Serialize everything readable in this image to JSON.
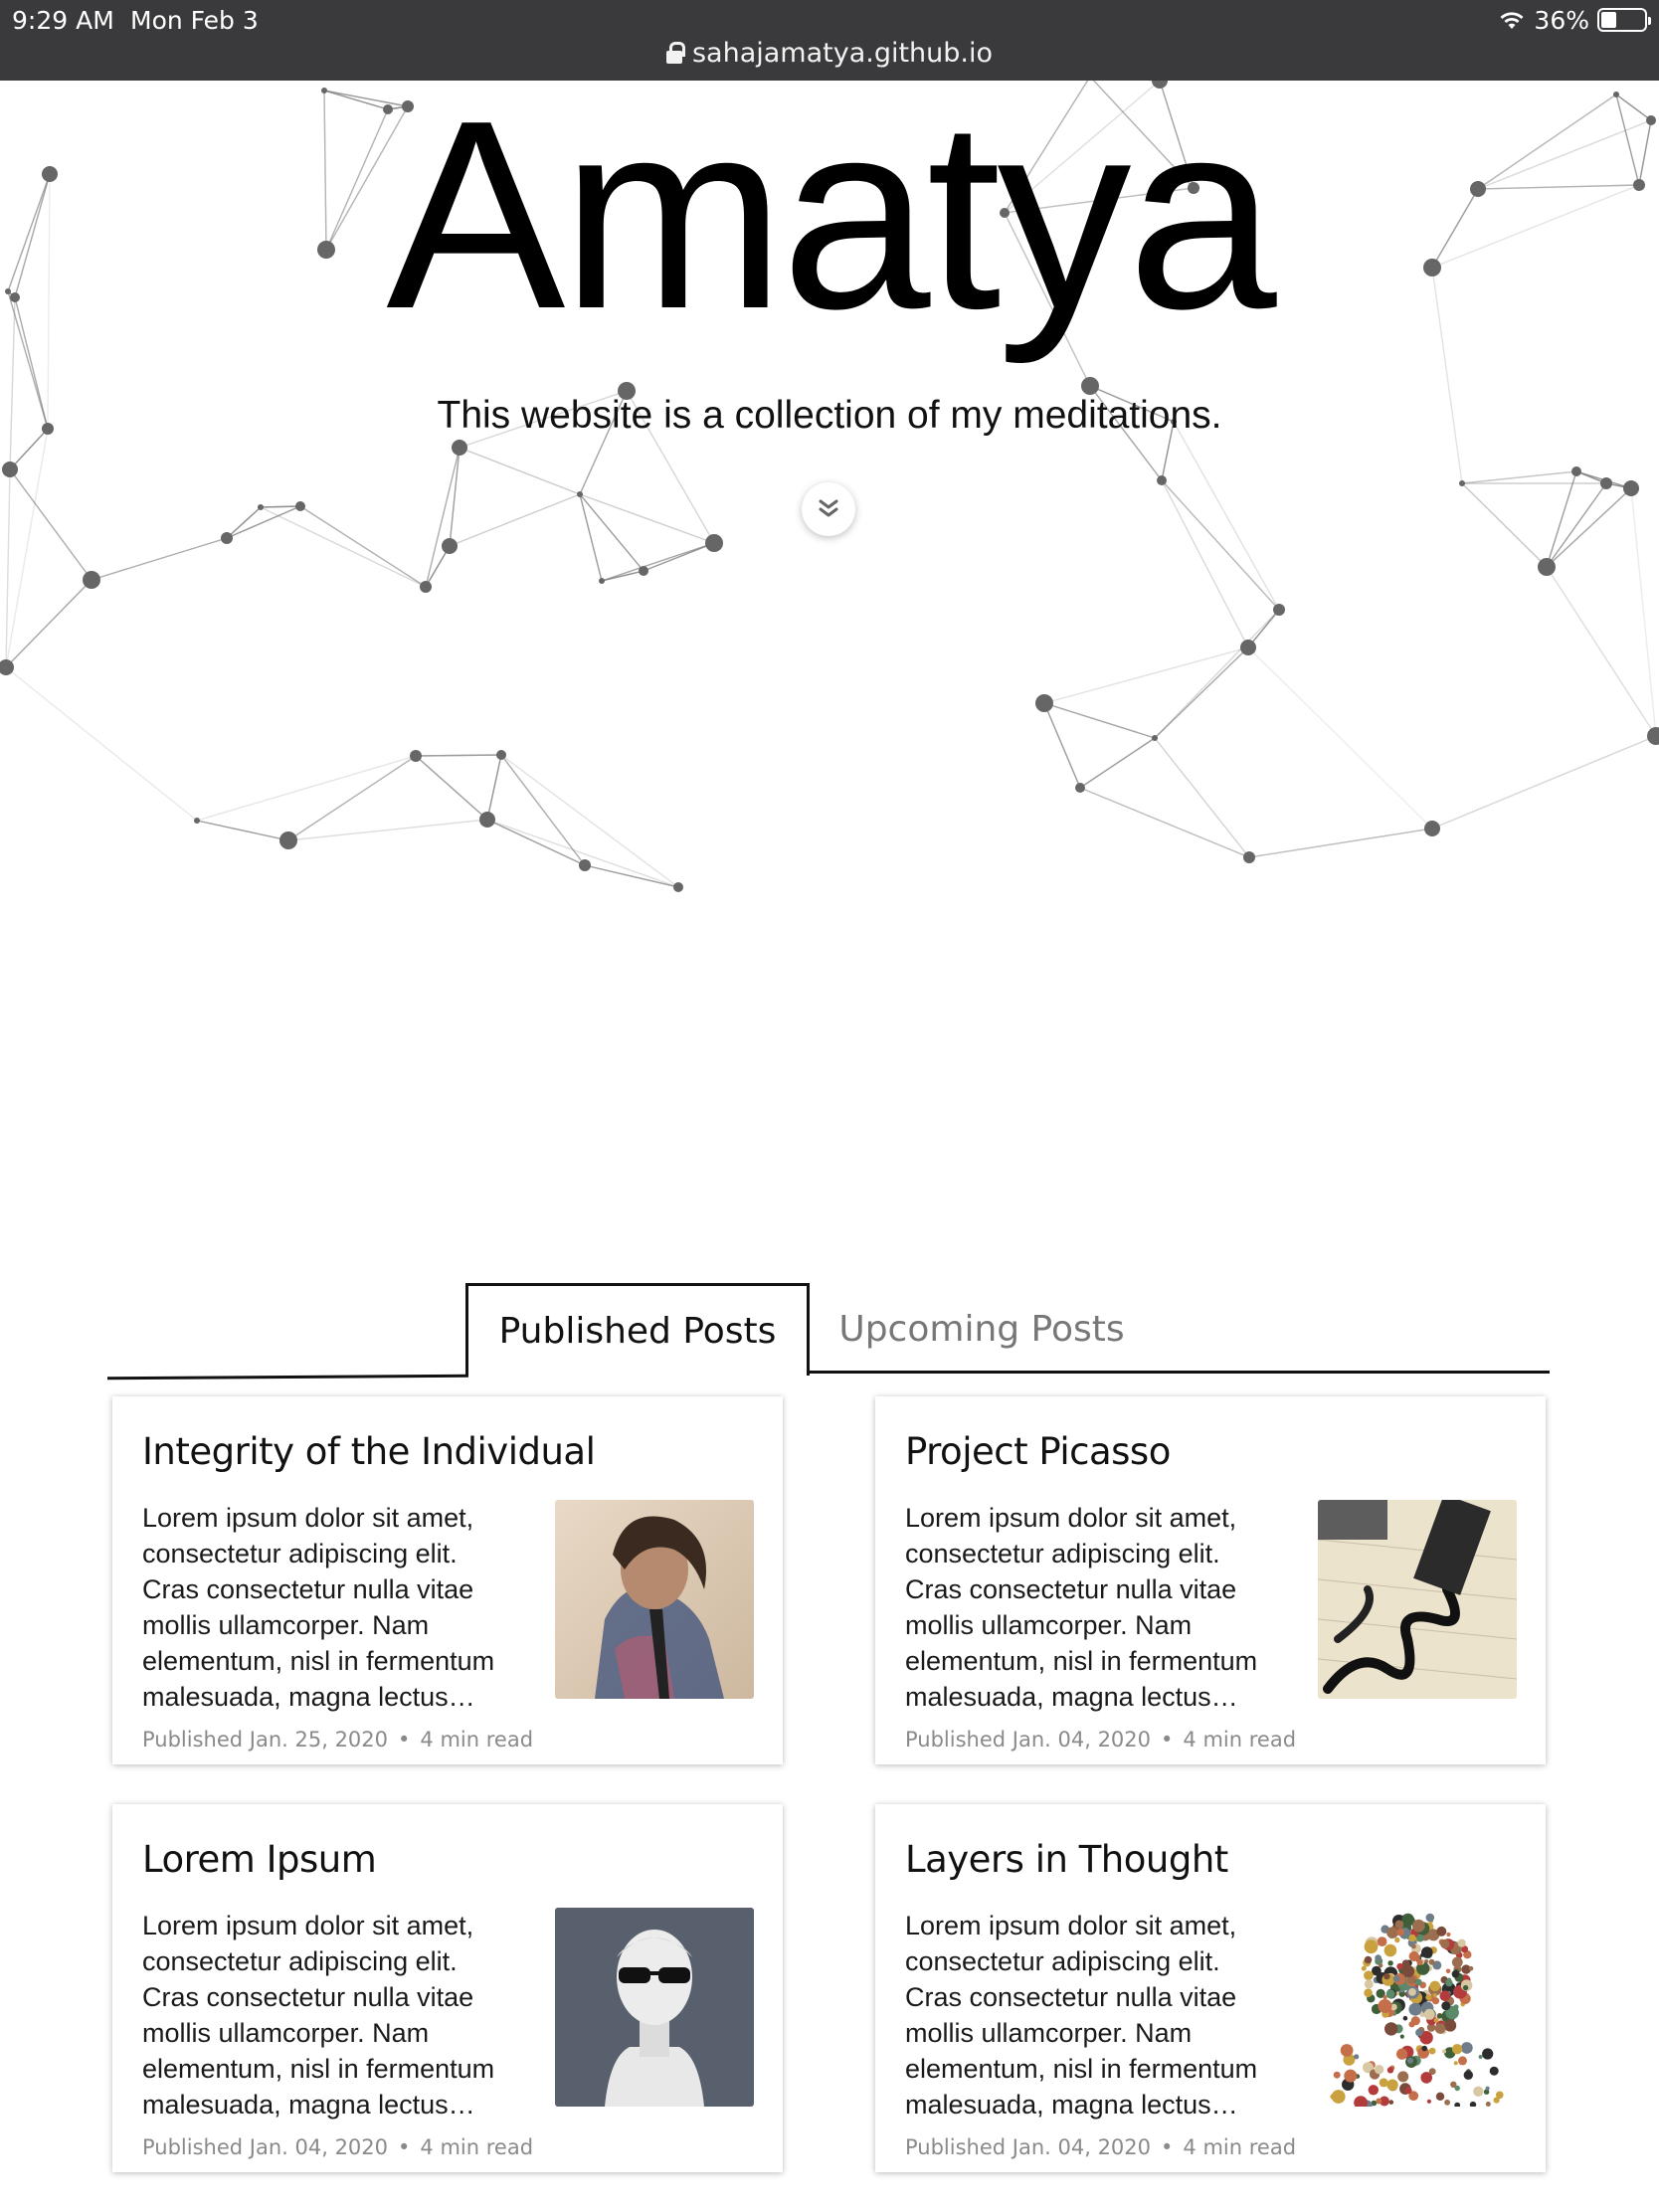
{
  "status_bar": {
    "time": "9:29 AM",
    "date": "Mon Feb 3",
    "battery": "36%",
    "battery_level": 0.36,
    "url": "sahajamatya.github.io"
  },
  "hero": {
    "title": "Amatya",
    "subtitle": "This website is a collection of my meditations.",
    "scroll_icon": "double-chevron-down-icon"
  },
  "tabs": [
    {
      "label": "Published Posts",
      "active": true
    },
    {
      "label": "Upcoming Posts",
      "active": false
    }
  ],
  "posts": [
    {
      "title": "Integrity of the Individual",
      "excerpt": "Lorem ipsum dolor sit amet, consectetur adipiscing elit. Cras consectetur nulla vitae mollis ullamcorper. Nam elementum, nisl in fermentum malesuada, magna lectus…",
      "published": "Published Jan. 25, 2020",
      "read_time": "4 min read",
      "image": "portrait-painting-thumbnail"
    },
    {
      "title": "Project Picasso",
      "excerpt": "Lorem ipsum dolor sit amet, consectetur adipiscing elit. Cras consectetur nulla vitae mollis ullamcorper. Nam elementum, nisl in fermentum malesuada, magna lectus…",
      "published": "Published Jan. 04, 2020",
      "read_time": "4 min read",
      "image": "marker-drawing-thumbnail"
    },
    {
      "title": "Lorem Ipsum",
      "excerpt": "Lorem ipsum dolor sit amet, consectetur adipiscing elit. Cras consectetur nulla vitae mollis ullamcorper. Nam elementum, nisl in fermentum malesuada, magna lectus…",
      "published": "Published Jan. 04, 2020",
      "read_time": "4 min read",
      "image": "bust-with-sunglasses-thumbnail"
    },
    {
      "title": "Layers in Thought",
      "excerpt": "Lorem ipsum dolor sit amet, consectetur adipiscing elit. Cras consectetur nulla vitae mollis ullamcorper. Nam elementum, nisl in fermentum malesuada, magna lectus…",
      "published": "Published Jan. 04, 2020",
      "read_time": "4 min read",
      "image": "collage-head-thumbnail"
    }
  ],
  "meta_separator": "•"
}
